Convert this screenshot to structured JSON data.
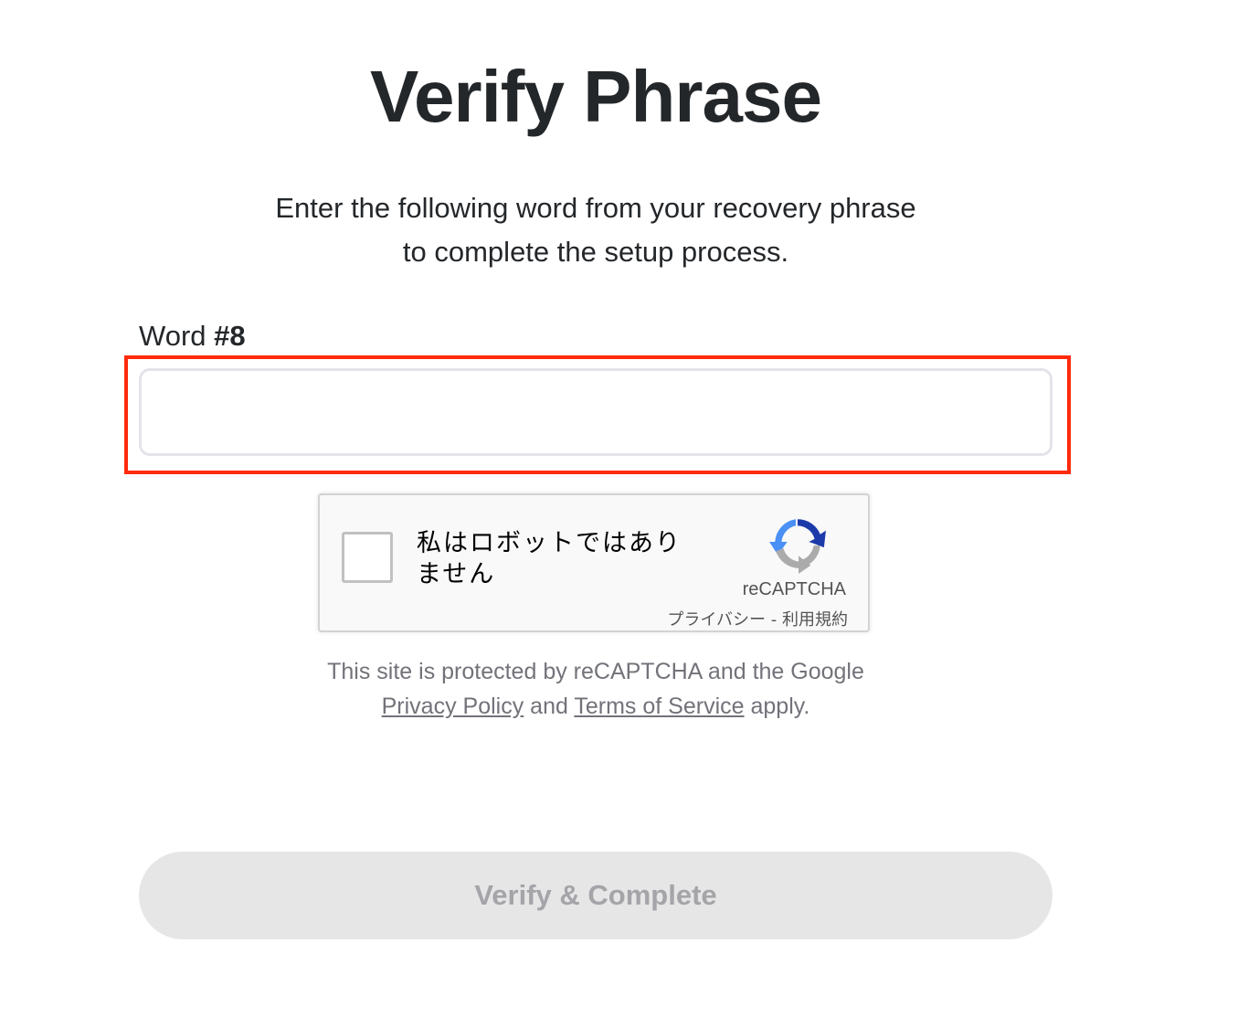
{
  "page": {
    "title": "Verify Phrase",
    "subtitle_line1": "Enter the following word from your recovery phrase",
    "subtitle_line2": "to complete the setup process."
  },
  "word_field": {
    "label_prefix": "Word ",
    "label_number": "#8",
    "value": "",
    "placeholder": ""
  },
  "recaptcha": {
    "checkbox_label": "私はロボットではありません",
    "brand": "reCAPTCHA",
    "privacy_link": "プライバシー",
    "separator": " - ",
    "terms_link": "利用規約",
    "checked": false,
    "logo_icon": "recaptcha-logo-icon"
  },
  "protection_note": {
    "line1": "This site is protected by reCAPTCHA and the Google",
    "privacy_policy": "Privacy Policy",
    "and": " and ",
    "terms_of_service": "Terms of Service",
    "apply": " apply."
  },
  "actions": {
    "verify_label": "Verify & Complete",
    "verify_disabled": true
  },
  "colors": {
    "highlight": "#ff2a0a",
    "text": "#24272a",
    "muted": "#72727a",
    "button_bg": "#e6e6e6",
    "button_text": "#a4a4a9"
  }
}
